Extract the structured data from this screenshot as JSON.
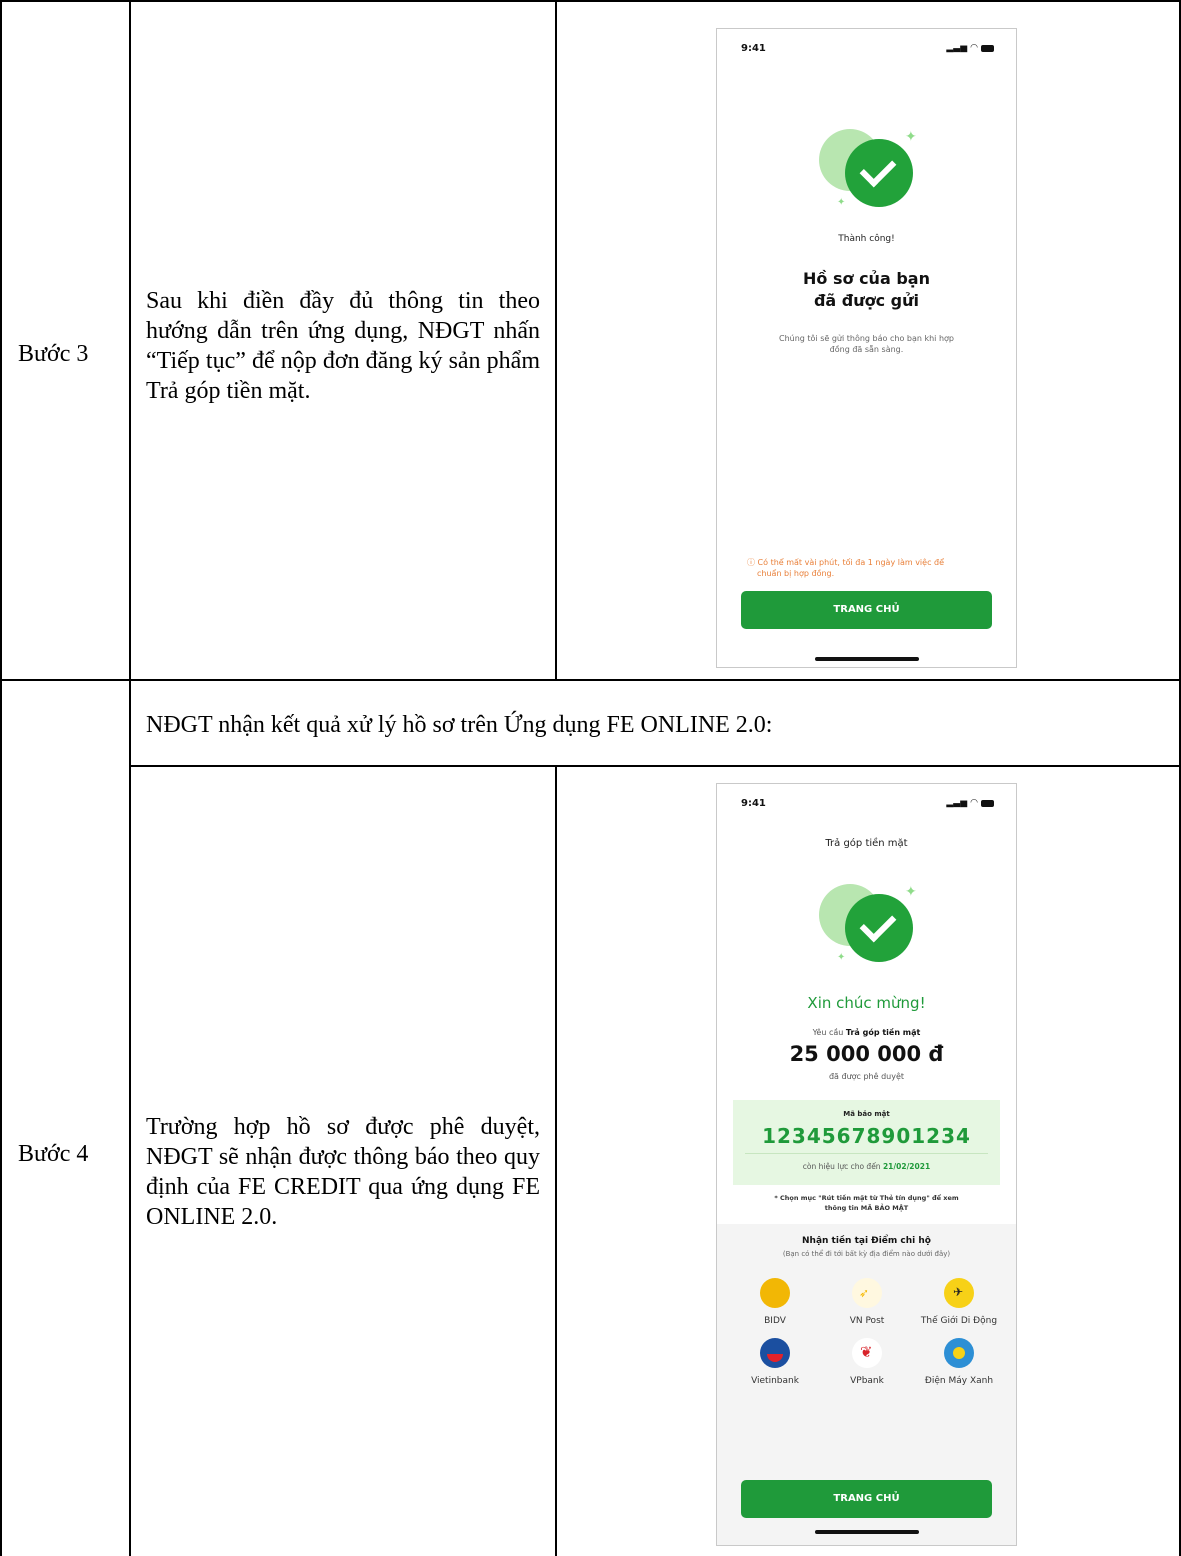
{
  "row_step3": {
    "label": "Bước 3",
    "description": "Sau khi điền đầy đủ thông tin theo hướng dẫn trên ứng dụng, NĐGT nhấn “Tiếp tục” để nộp đơn đăng ký sản phẩm Trả góp tiền mặt.",
    "phone": {
      "time": "9:41",
      "status_title": "Thành công!",
      "heading_line1": "Hồ sơ của bạn",
      "heading_line2": "đã được gửi",
      "message_line1": "Chúng tôi sẽ gửi thông báo cho bạn khi hợp",
      "message_line2": "đồng đã sẵn sàng.",
      "warning_line1": "ⓘ Có thể mất vài phút, tối đa 1 ngày làm việc để",
      "warning_line2": "chuẩn bị hợp đồng.",
      "button_label": "TRANG CHỦ"
    }
  },
  "section_note": "NĐGT nhận kết quả xử lý hồ sơ trên Ứng dụng FE ONLINE 2.0:",
  "row_step4": {
    "label": "Bước 4",
    "description": "Trường hợp hồ sơ được phê duyệt, NĐGT sẽ nhận được thông báo theo quy định của FE CREDIT qua ứng dụng FE ONLINE 2.0.",
    "phone": {
      "time": "9:41",
      "screen_title": "Trả góp tiền mặt",
      "congrats": "Xin chúc mừng!",
      "request_prefix": "Yêu cầu ",
      "request_product": "Trả góp tiền mặt",
      "amount": "25 000 000 đ",
      "approved_text": "đã được phê duyệt",
      "code_label": "Mã bảo mật",
      "code_value": "12345678901234",
      "valid_prefix": "còn hiệu lực cho đến ",
      "valid_date": "21/02/2021",
      "hint_line1": "* Chọn mục \"Rút tiền mặt từ Thẻ tín dụng\" để xem",
      "hint_line2": "thông tin MÃ BẢO MẬT",
      "pickup_title": "Nhận tiền tại Điểm chi hộ",
      "pickup_subtitle": "(Bạn có thể đi tới bất kỳ địa điểm nào dưới đây)",
      "partners": [
        {
          "name": "BIDV",
          "color": "#f2b705"
        },
        {
          "name": "VN Post",
          "color": "#f5b800"
        },
        {
          "name": "Thế Giới Di Động",
          "color": "#f7d117"
        },
        {
          "name": "Vietinbank",
          "color": "#1b4fa0"
        },
        {
          "name": "VPbank",
          "color": "#d8232a"
        },
        {
          "name": "Điện Máy Xanh",
          "color": "#2d8fd5"
        }
      ],
      "button_label": "TRANG CHỦ"
    }
  },
  "colors": {
    "primary_green": "#1f9a3a",
    "warning_orange": "#e9803a",
    "code_bg": "#e6f7e2"
  }
}
